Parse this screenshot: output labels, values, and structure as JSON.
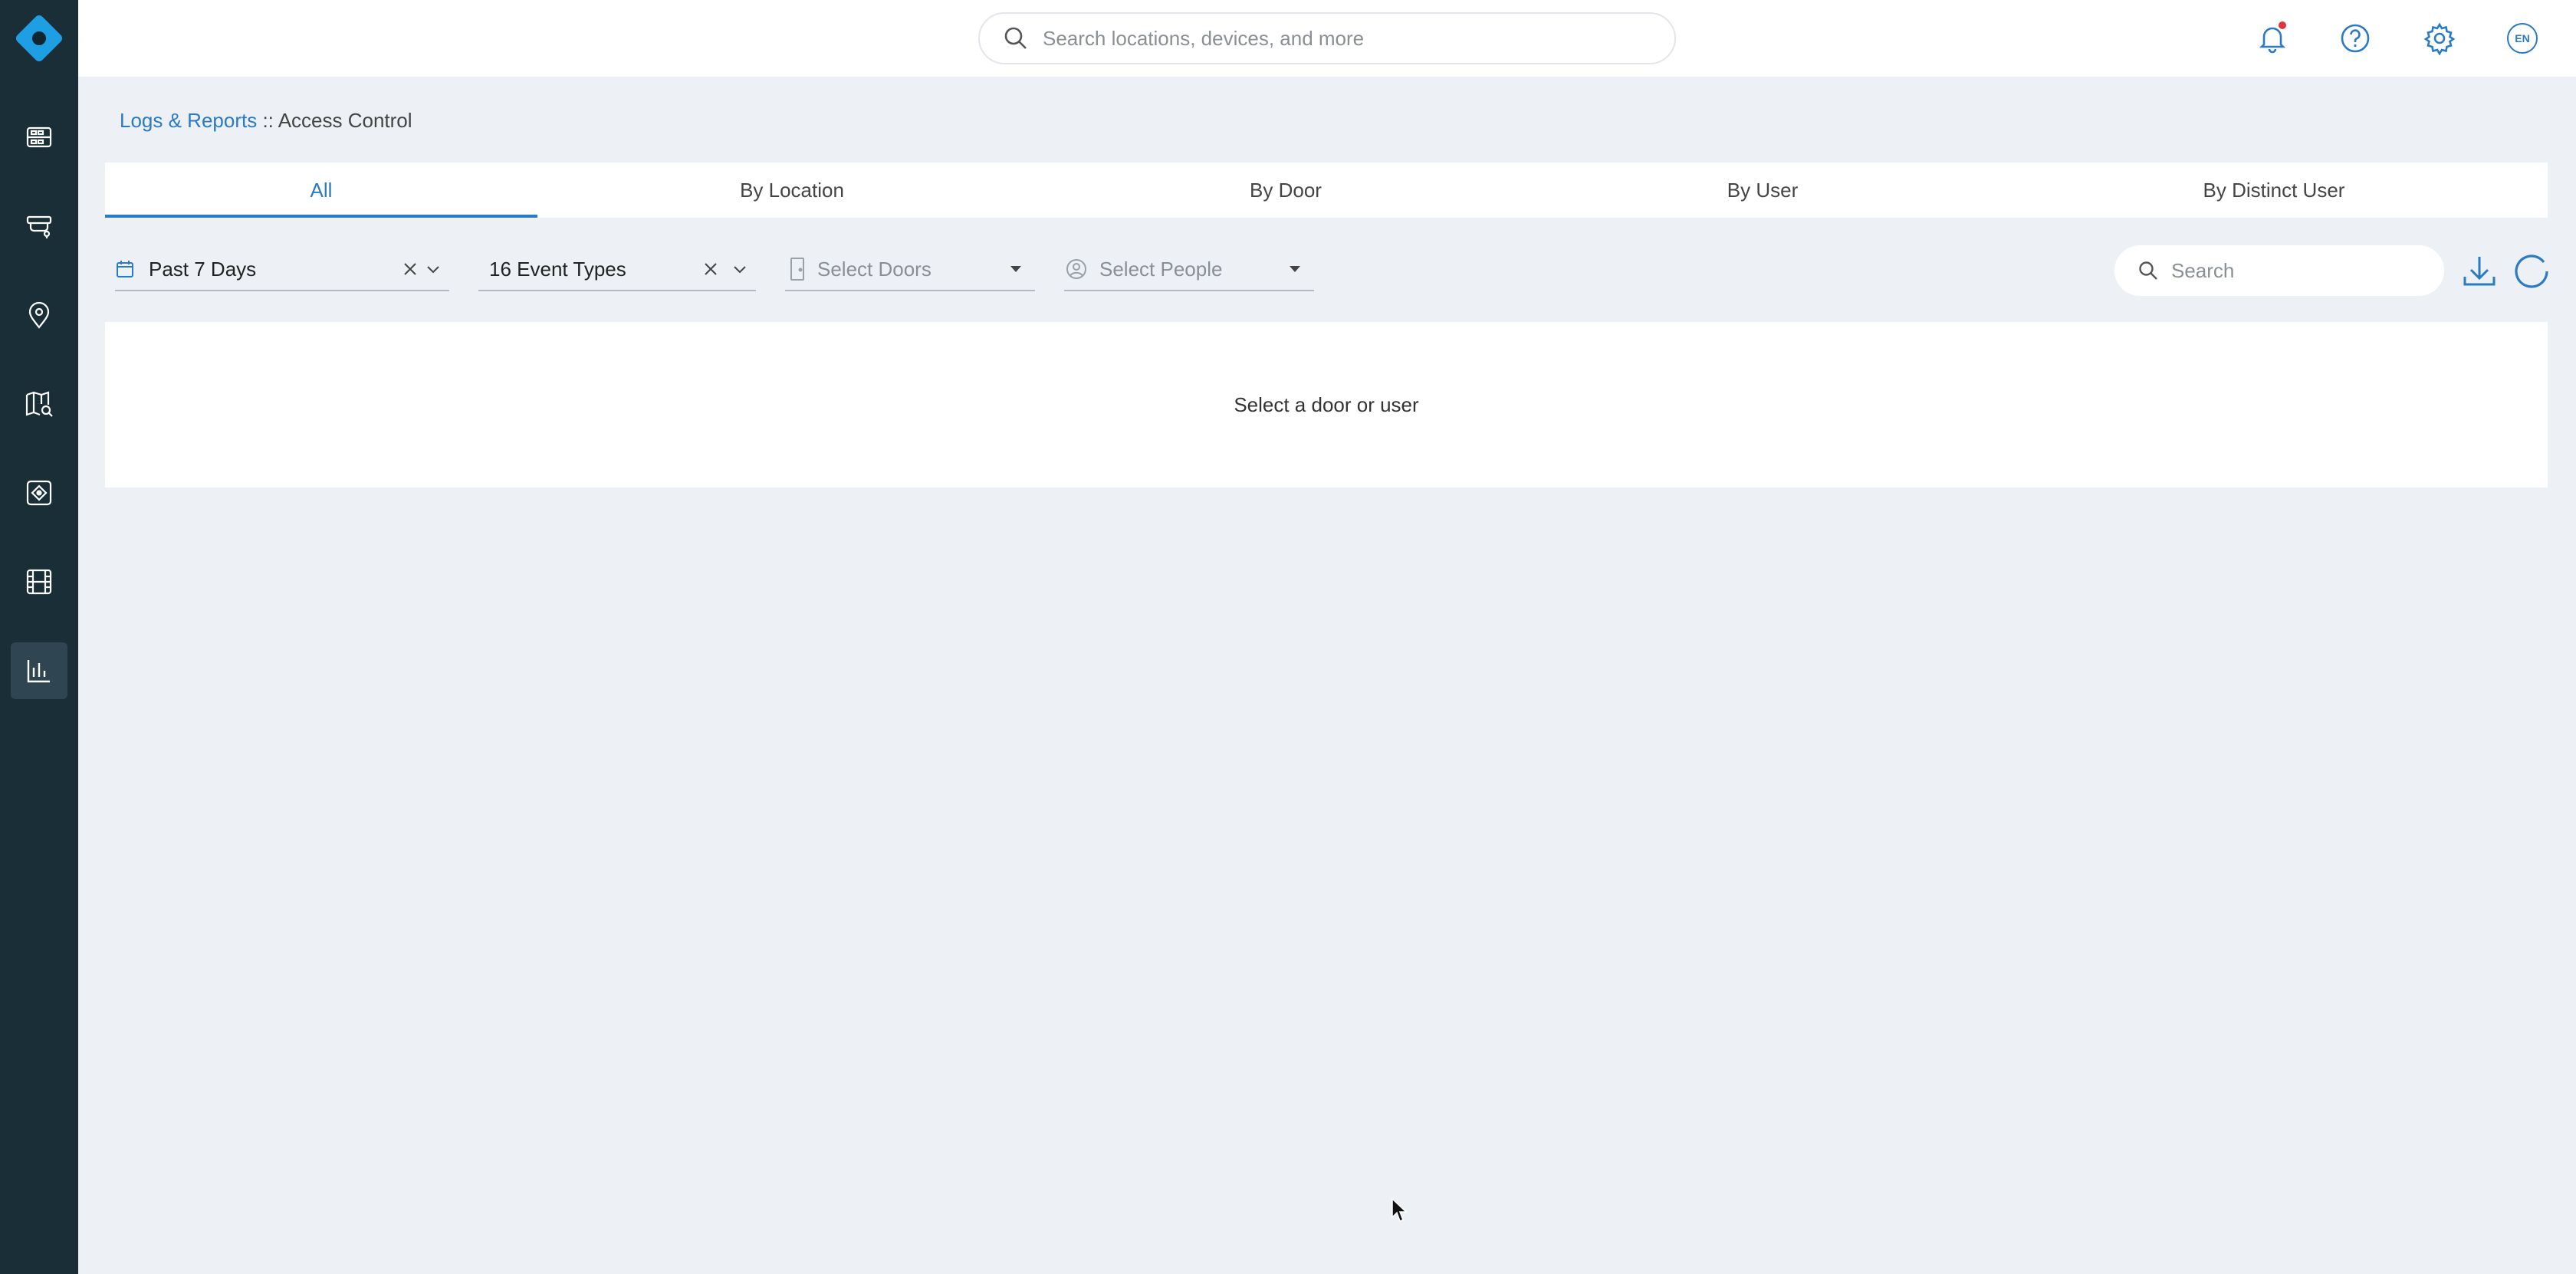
{
  "sidebar": {
    "items": [
      {
        "icon": "dashboard-icon",
        "active": false
      },
      {
        "icon": "camera-icon",
        "active": false
      },
      {
        "icon": "location-pin-icon",
        "active": false
      },
      {
        "icon": "map-search-icon",
        "active": false
      },
      {
        "icon": "integrations-icon",
        "active": false
      },
      {
        "icon": "video-film-icon",
        "active": false
      },
      {
        "icon": "reports-chart-icon",
        "active": true
      }
    ]
  },
  "topbar": {
    "search_placeholder": "Search locations, devices, and more",
    "language": "EN",
    "icons": [
      "bell-icon",
      "help-icon",
      "settings-gear-icon",
      "language-icon"
    ]
  },
  "breadcrumb": {
    "parent": "Logs & Reports",
    "separator": " :: ",
    "current": "Access Control"
  },
  "tabs": [
    {
      "label": "All",
      "active": true
    },
    {
      "label": "By Location",
      "active": false
    },
    {
      "label": "By Door",
      "active": false
    },
    {
      "label": "By User",
      "active": false
    },
    {
      "label": "By Distinct User",
      "active": false
    }
  ],
  "filters": {
    "date_range": "Past 7 Days",
    "event_types": "16 Event Types",
    "doors_placeholder": "Select Doors",
    "people_placeholder": "Select People",
    "search_placeholder": "Search"
  },
  "empty_state": {
    "message": "Select a door or user"
  },
  "colors": {
    "sidebar_bg": "#1a2e38",
    "accent": "#2a7ac4",
    "logo": "#1e9ee3",
    "page_bg": "#edf0f4",
    "notification_dot": "#e0343c"
  }
}
